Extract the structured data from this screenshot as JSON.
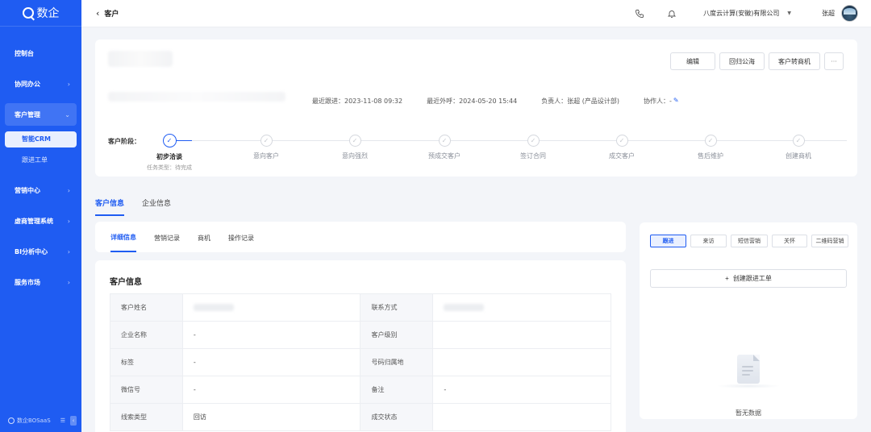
{
  "sidebar": {
    "logo": "数企",
    "items": [
      {
        "label": "控制台",
        "chevron": false
      },
      {
        "label": "协同办公",
        "chevron": true
      },
      {
        "label": "客户管理",
        "chevron": true,
        "open": true
      },
      {
        "label": "营销中心",
        "chevron": true
      },
      {
        "label": "虚商管理系统",
        "chevron": true
      },
      {
        "label": "BI分析中心",
        "chevron": true
      },
      {
        "label": "服务市场",
        "chevron": true
      }
    ],
    "sub_items": [
      "智能CRM",
      "跟进工单"
    ],
    "footer": "数企BOSaaS"
  },
  "topbar": {
    "back_label": "客户",
    "company": "八度云计算(安徽)有限公司",
    "user": "张超"
  },
  "header": {
    "buttons": [
      "编辑",
      "回归公海",
      "客户转商机",
      "···"
    ],
    "meta": {
      "last_follow": "最近跟进：2023-11-08 09:32",
      "last_call": "最近外呼：2024-05-20 15:44",
      "owner": "负责人：张超 (产品设计部)",
      "collaborator": "协作人：-"
    },
    "stage_label": "客户阶段：",
    "stages": [
      {
        "label": "初步洽谈",
        "sub": "任务类型：待完成",
        "active": true
      },
      {
        "label": "意向客户"
      },
      {
        "label": "意向强烈"
      },
      {
        "label": "预成交客户"
      },
      {
        "label": "签订合同"
      },
      {
        "label": "成交客户"
      },
      {
        "label": "售后维护"
      },
      {
        "label": "创建商机"
      }
    ]
  },
  "main_tabs": [
    "客户信息",
    "企业信息"
  ],
  "sub_tabs": [
    "详细信息",
    "营销记录",
    "商机",
    "操作记录"
  ],
  "info": {
    "title": "客户信息",
    "rows": [
      {
        "k1": "客户姓名",
        "v1": "",
        "k2": "联系方式",
        "v2": ""
      },
      {
        "k1": "企业名称",
        "v1": "-",
        "k2": "客户级别",
        "v2": ""
      },
      {
        "k1": "标签",
        "v1": "-",
        "k2": "号码归属地",
        "v2": ""
      },
      {
        "k1": "微信号",
        "v1": "-",
        "k2": "备注",
        "v2": "-"
      },
      {
        "k1": "线索类型",
        "v1": "回访",
        "k2": "成交状态",
        "v2": ""
      }
    ]
  },
  "right_panel": {
    "tabs": [
      "跟进",
      "来访",
      "短信营销",
      "关怀",
      "二维码营销"
    ],
    "create_button": "创建跟进工单",
    "empty_text": "暂无数据"
  },
  "colors": {
    "primary": "#1f5cf2"
  }
}
